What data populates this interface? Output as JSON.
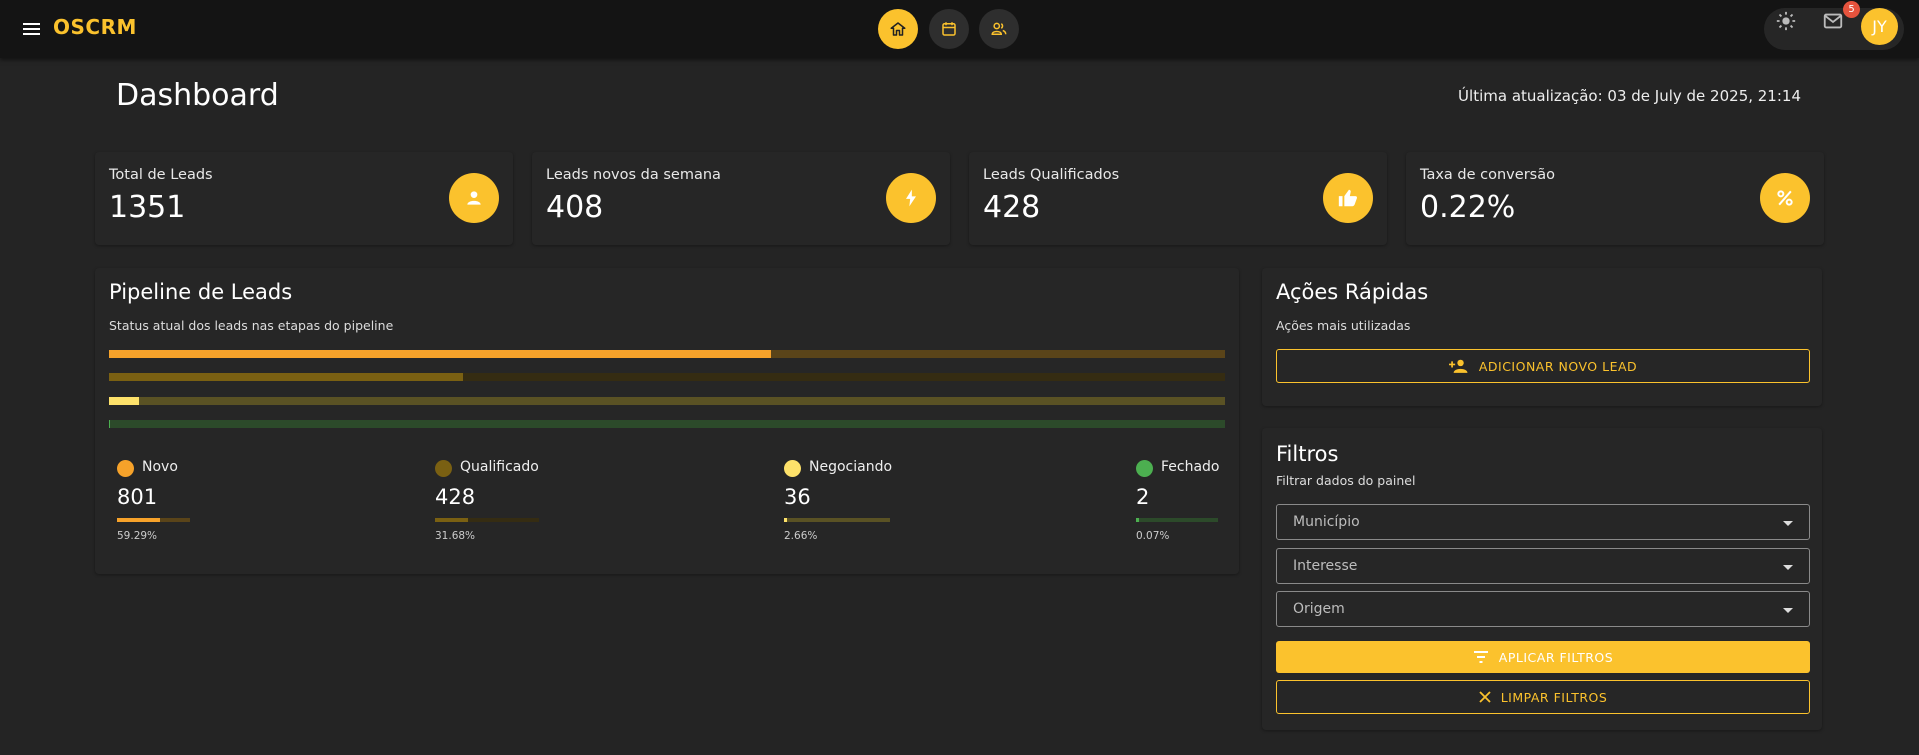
{
  "app": {
    "logo": "OSCRM"
  },
  "topbar": {
    "nav": [
      {
        "icon": "home-icon",
        "active": true
      },
      {
        "icon": "calendar-icon",
        "active": false
      },
      {
        "icon": "users-icon",
        "active": false
      }
    ],
    "notifications_count": "5",
    "avatar_initials": "JY"
  },
  "header": {
    "title": "Dashboard",
    "last_updated": "Última atualização: 03 de July de 2025, 21:14"
  },
  "stats": [
    {
      "label": "Total de Leads",
      "value": "1351",
      "icon": "person-icon"
    },
    {
      "label": "Leads novos da semana",
      "value": "408",
      "icon": "bolt-icon"
    },
    {
      "label": "Leads Qualificados",
      "value": "428",
      "icon": "thumbs-up-icon"
    },
    {
      "label": "Taxa de conversão",
      "value": "0.22%",
      "icon": "percent-icon"
    }
  ],
  "pipeline": {
    "title": "Pipeline de Leads",
    "subtitle": "Status atual dos leads nas etapas do pipeline",
    "stages": [
      {
        "name": "Novo",
        "count": "801",
        "percent": "59.29%",
        "fraction": 0.5929,
        "color": "#f6a22a",
        "track": "#5a4419"
      },
      {
        "name": "Qualificado",
        "count": "428",
        "percent": "31.68%",
        "fraction": 0.3168,
        "color": "#7a6012",
        "track": "#352c12"
      },
      {
        "name": "Negociando",
        "count": "36",
        "percent": "2.66%",
        "fraction": 0.0266,
        "color": "#fde16a",
        "track": "#5a5224"
      },
      {
        "name": "Fechado",
        "count": "2",
        "percent": "0.07%",
        "fraction": 0.0007,
        "color": "#4caf50",
        "track": "#2c4a2a"
      }
    ]
  },
  "quick_actions": {
    "title": "Ações Rápidas",
    "subtitle": "Ações mais utilizadas",
    "add_lead_label": "ADICIONAR NOVO LEAD"
  },
  "filters": {
    "title": "Filtros",
    "subtitle": "Filtrar dados do painel",
    "fields": [
      "Município",
      "Interesse",
      "Origem"
    ],
    "apply_label": "APLICAR FILTROS",
    "clear_label": "LIMPAR FILTROS"
  },
  "colors": {
    "accent": "#fbc22d",
    "background": "#242424",
    "card": "#262626"
  }
}
